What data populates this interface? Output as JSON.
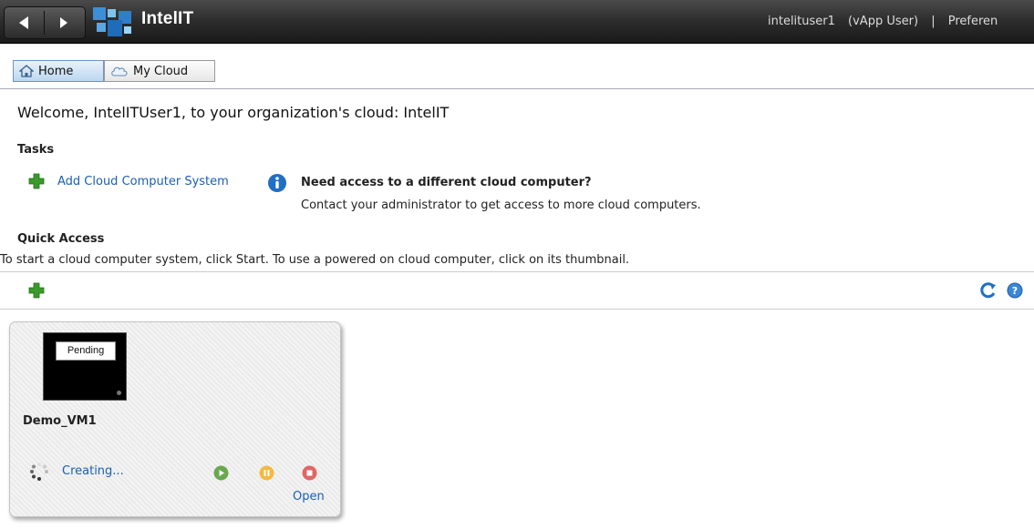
{
  "app": {
    "title": "IntelIT"
  },
  "header": {
    "username": "intelituser1",
    "role": "(vApp User)",
    "separator": "|",
    "preferences_label": "Preferen"
  },
  "tabs": [
    {
      "label": "Home",
      "icon": "home-icon",
      "active": true
    },
    {
      "label": "My Cloud",
      "icon": "cloud-icon",
      "active": false
    }
  ],
  "welcome": "Welcome, IntelITUser1, to your organization's cloud: IntelIT",
  "tasks": {
    "heading": "Tasks",
    "add_label": "Add Cloud Computer System",
    "info_title": "Need access to a different cloud computer?",
    "info_text": "Contact your administrator to get access to more cloud computers."
  },
  "quick_access": {
    "heading": "Quick Access",
    "description": "To start a cloud computer system, click Start. To use a powered on cloud computer, click on its thumbnail."
  },
  "vm": {
    "thumbnail_badge": "Pending",
    "name": "Demo_VM1",
    "status": "Creating...",
    "open_label": "Open"
  },
  "colors": {
    "link": "#1a5fb4",
    "plus_green": "#3a9a2a",
    "start_green": "#6aa84f",
    "pause_orange": "#f4b942",
    "stop_red": "#e06666"
  }
}
